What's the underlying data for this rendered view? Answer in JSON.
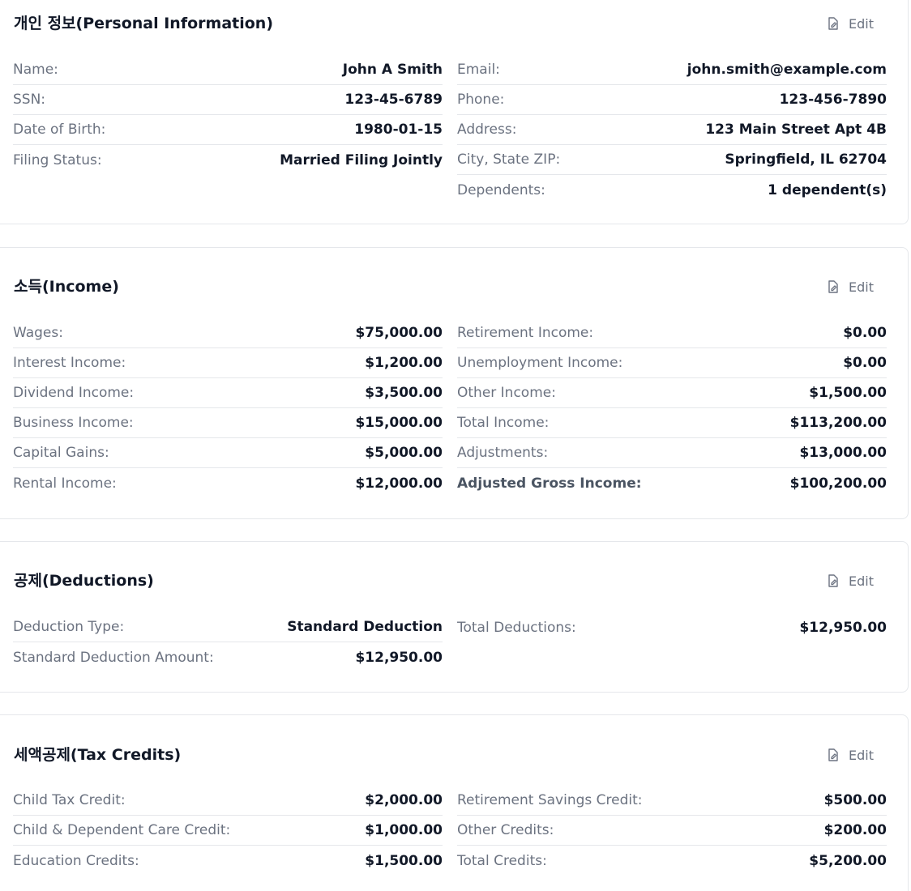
{
  "edit_label": "Edit",
  "sections": {
    "personal": {
      "title": "개인 정보(Personal Information)",
      "left": [
        {
          "label": "Name:",
          "value": "John A Smith"
        },
        {
          "label": "SSN:",
          "value": "123-45-6789"
        },
        {
          "label": "Date of Birth:",
          "value": "1980-01-15"
        },
        {
          "label": "Filing Status:",
          "value": "Married Filing Jointly"
        }
      ],
      "right": [
        {
          "label": "Email:",
          "value": "john.smith@example.com"
        },
        {
          "label": "Phone:",
          "value": "123-456-7890"
        },
        {
          "label": "Address:",
          "value": "123 Main Street Apt 4B"
        },
        {
          "label": "City, State ZIP:",
          "value": "Springfield, IL 62704"
        },
        {
          "label": "Dependents:",
          "value": "1 dependent(s)"
        }
      ]
    },
    "income": {
      "title": "소득(Income)",
      "left": [
        {
          "label": "Wages:",
          "value": "$75,000.00"
        },
        {
          "label": "Interest Income:",
          "value": "$1,200.00"
        },
        {
          "label": "Dividend Income:",
          "value": "$3,500.00"
        },
        {
          "label": "Business Income:",
          "value": "$15,000.00"
        },
        {
          "label": "Capital Gains:",
          "value": "$5,000.00"
        },
        {
          "label": "Rental Income:",
          "value": "$12,000.00"
        }
      ],
      "right": [
        {
          "label": "Retirement Income:",
          "value": "$0.00"
        },
        {
          "label": "Unemployment Income:",
          "value": "$0.00"
        },
        {
          "label": "Other Income:",
          "value": "$1,500.00"
        },
        {
          "label": "Total Income:",
          "value": "$113,200.00"
        },
        {
          "label": "Adjustments:",
          "value": "$13,000.00"
        },
        {
          "label": "Adjusted Gross Income:",
          "value": "$100,200.00"
        }
      ]
    },
    "deductions": {
      "title": "공제(Deductions)",
      "left": [
        {
          "label": "Deduction Type:",
          "value": "Standard Deduction"
        },
        {
          "label": "Standard Deduction Amount:",
          "value": "$12,950.00"
        }
      ],
      "right": [
        {
          "label": "Total Deductions:",
          "value": "$12,950.00"
        }
      ]
    },
    "credits": {
      "title": "세액공제(Tax Credits)",
      "left": [
        {
          "label": "Child Tax Credit:",
          "value": "$2,000.00"
        },
        {
          "label": "Child & Dependent Care Credit:",
          "value": "$1,000.00"
        },
        {
          "label": "Education Credits:",
          "value": "$1,500.00"
        }
      ],
      "right": [
        {
          "label": "Retirement Savings Credit:",
          "value": "$500.00"
        },
        {
          "label": "Other Credits:",
          "value": "$200.00"
        },
        {
          "label": "Total Credits:",
          "value": "$5,200.00"
        }
      ]
    }
  }
}
